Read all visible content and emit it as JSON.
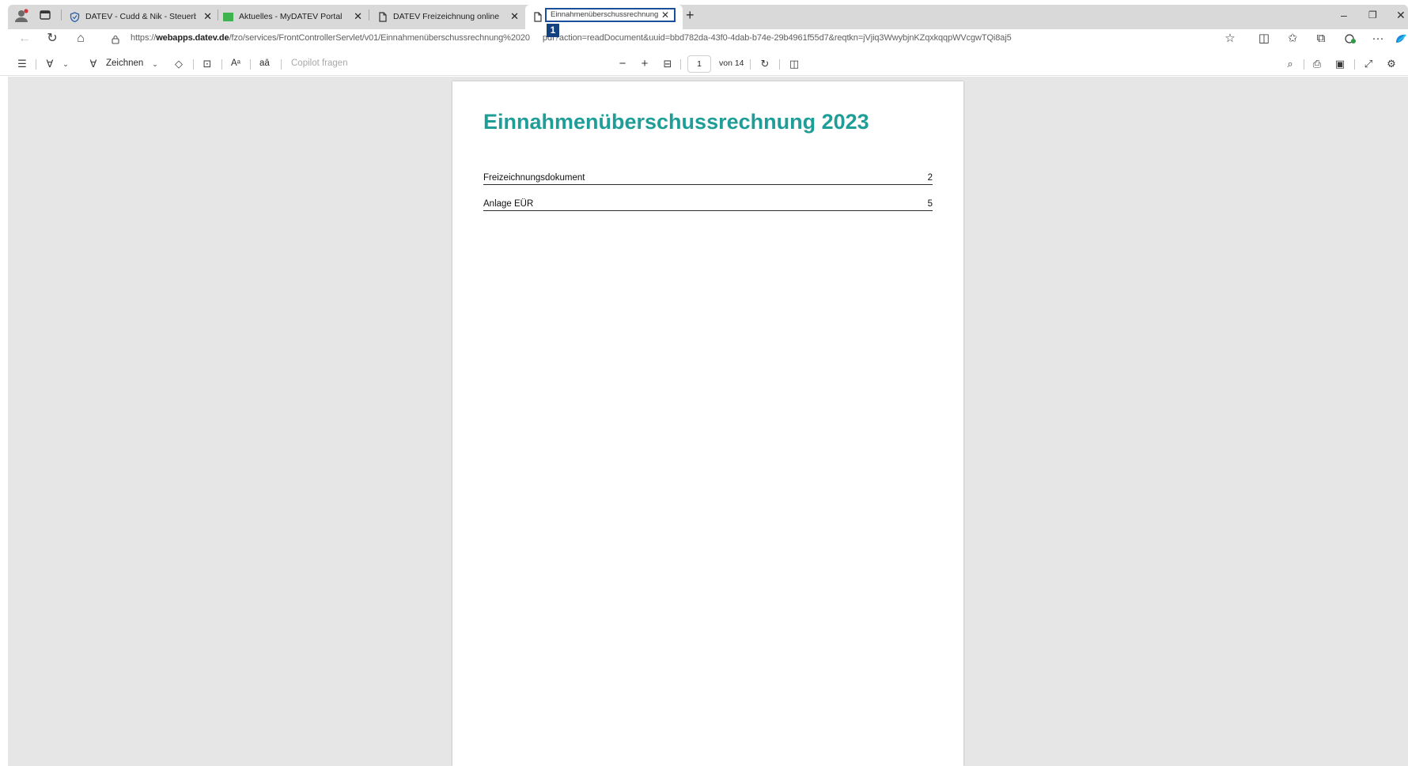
{
  "tabs": [
    {
      "title": "DATEV - Cudd & Nik - Steuerber",
      "icon": "shield-icon"
    },
    {
      "title": "Aktuelles - MyDATEV Portal",
      "icon": "green-square-icon"
    },
    {
      "title": "DATEV Freizeichnung online",
      "icon": "document-icon"
    },
    {
      "title": "Einnahmenüberschussrechnung",
      "icon": "document-icon"
    }
  ],
  "tab_close_glyph": "✕",
  "new_tab_glyph": "+",
  "marker_label": "1",
  "address": {
    "prefix": "https://",
    "domain": "webapps.datev.de",
    "path": "/fzo/services/FrontControllerServlet/v01/Einnahmenüberschussrechnung%2020",
    "rest": "pdf?action=readDocument&uuid=bbd782da-43f0-4dab-b74e-29b4961f55d7&reqtkn=jVjiq3WwybjnKZqxkqqpWVcgwTQi8aj5"
  },
  "toolbar": {
    "draw_label": "Zeichnen",
    "read_aloud_label": "Aᵃ",
    "translate_label": "aā",
    "copilot_label": "Copilot fragen",
    "page_current": "1",
    "page_total": "von 14",
    "zoom_out": "−",
    "zoom_in": "+"
  },
  "document": {
    "title": "Einnahmenüberschussrechnung 2023",
    "toc": [
      {
        "label": "Freizeichnungsdokument",
        "page": "2"
      },
      {
        "label": "Anlage EÜR",
        "page": "5"
      }
    ]
  },
  "colors": {
    "title_teal": "#1f9d97",
    "marker_blue": "#14417f",
    "viewer_bg": "#e6e6e6"
  }
}
